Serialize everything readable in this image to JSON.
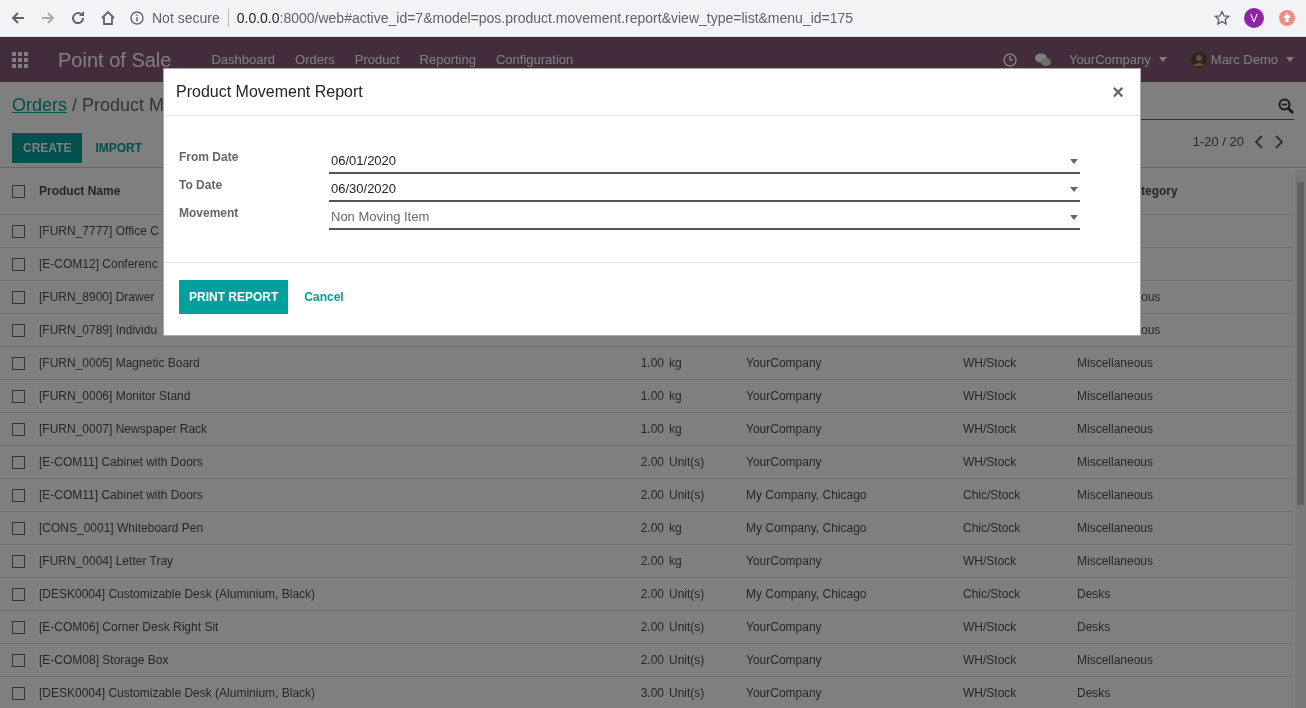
{
  "browser": {
    "security": "Not secure",
    "url_host": "0.0.0.0",
    "url_rest": ":8000/web#active_id=7&model=pos.product.movement.report&view_type=list&menu_id=175",
    "profile_letter": "V"
  },
  "navbar": {
    "app_title": "Point of Sale",
    "menu": [
      "Dashboard",
      "Orders",
      "Product",
      "Reporting",
      "Configuration"
    ],
    "company": "YourCompany",
    "user": "Marc Demo"
  },
  "breadcrumb": {
    "parent": "Orders",
    "current": "/ Product M"
  },
  "control_buttons": [
    {
      "label": "CREATE",
      "kind": "primary"
    },
    {
      "label": "IMPORT",
      "kind": "link"
    }
  ],
  "pager": "1-20 / 20",
  "table": {
    "all_checked": false,
    "columns": [
      {
        "label": "Product Name"
      },
      {
        "label": "tegory",
        "under_dialog": true
      }
    ],
    "rows": [
      {
        "name": "[FURN_7777] Office C",
        "checked": false
      },
      {
        "name": "[E-COM12] Conferenc",
        "checked": false
      },
      {
        "name": "[FURN_8900] Drawer",
        "category": "ous",
        "under_dialog": true,
        "checked": false
      },
      {
        "name": "[FURN_0789] Individu",
        "category": "ous",
        "under_dialog": true,
        "checked": false
      },
      {
        "checked": false,
        "name": "[FURN_0005] Magnetic Board",
        "quantity": "1.00",
        "unit": "kg",
        "company": "YourCompany",
        "location": "WH/Stock",
        "category": "Miscellaneous"
      },
      {
        "checked": false,
        "name": "[FURN_0006] Monitor Stand",
        "quantity": "1.00",
        "unit": "kg",
        "company": "YourCompany",
        "location": "WH/Stock",
        "category": "Miscellaneous"
      },
      {
        "checked": false,
        "name": "[FURN_0007] Newspaper Rack",
        "quantity": "1.00",
        "unit": "kg",
        "company": "YourCompany",
        "location": "WH/Stock",
        "category": "Miscellaneous"
      },
      {
        "checked": false,
        "name": "[E-COM11] Cabinet with Doors",
        "quantity": "2.00",
        "unit": "Unit(s)",
        "company": "YourCompany",
        "location": "WH/Stock",
        "category": "Miscellaneous"
      },
      {
        "checked": false,
        "name": "[E-COM11] Cabinet with Doors",
        "quantity": "2.00",
        "unit": "Unit(s)",
        "company": "My Company, Chicago",
        "location": "Chic/Stock",
        "category": "Miscellaneous"
      },
      {
        "checked": false,
        "name": "[CONS_0001] Whiteboard Pen",
        "quantity": "2.00",
        "unit": "kg",
        "company": "My Company, Chicago",
        "location": "Chic/Stock",
        "category": "Miscellaneous"
      },
      {
        "checked": false,
        "name": "[FURN_0004] Letter Tray",
        "quantity": "2.00",
        "unit": "kg",
        "company": "YourCompany",
        "location": "WH/Stock",
        "category": "Miscellaneous"
      },
      {
        "checked": false,
        "name": "[DESK0004] Customizable Desk (Aluminium, Black)",
        "quantity": "2.00",
        "unit": "Unit(s)",
        "company": "My Company, Chicago",
        "location": "Chic/Stock",
        "category": "Desks"
      },
      {
        "checked": false,
        "name": "[E-COM06] Corner Desk Right Sit",
        "quantity": "2.00",
        "unit": "Unit(s)",
        "company": "YourCompany",
        "location": "WH/Stock",
        "category": "Desks"
      },
      {
        "checked": false,
        "name": "[E-COM08] Storage Box",
        "quantity": "2.00",
        "unit": "Unit(s)",
        "company": "YourCompany",
        "location": "WH/Stock",
        "category": "Miscellaneous"
      },
      {
        "checked": false,
        "name": "[DESK0004] Customizable Desk (Aluminium, Black)",
        "quantity": "3.00",
        "unit": "Unit(s)",
        "company": "YourCompany",
        "location": "WH/Stock",
        "category": "Desks"
      }
    ]
  },
  "dialog": {
    "title": "Product Movement Report",
    "close": "×",
    "fields": [
      {
        "label": "From Date",
        "value": "06/01/2020",
        "kind": "date"
      },
      {
        "label": "To Date",
        "value": "06/30/2020",
        "kind": "date"
      },
      {
        "label": "Movement",
        "value": "Non Moving Item",
        "kind": "select"
      }
    ],
    "primary_button": "PRINT REPORT",
    "cancel_button": "Cancel"
  }
}
